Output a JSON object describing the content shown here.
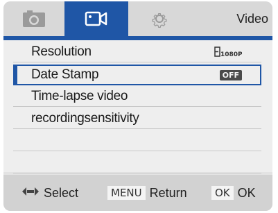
{
  "header": {
    "tabs": [
      {
        "name": "photo",
        "icon": "camera-icon",
        "active": false
      },
      {
        "name": "video",
        "icon": "video-camera-icon",
        "active": true
      },
      {
        "name": "setup",
        "icon": "gear-icon",
        "active": false
      }
    ],
    "mode_label": "Video"
  },
  "menu": {
    "items": [
      {
        "label": "Resolution",
        "value_icon": "1080p-icon",
        "selected": false
      },
      {
        "label": "Date Stamp",
        "value": "OFF",
        "selected": true
      },
      {
        "label": "Time-lapse video",
        "selected": false
      },
      {
        "label": "recordingsensitivity",
        "selected": false
      }
    ]
  },
  "footer": {
    "select_icon": "left-right-arrows-icon",
    "select_label": "Select",
    "menu_key": "MENU",
    "return_label": "Return",
    "ok_key": "OK",
    "ok_label": "OK"
  },
  "colors": {
    "accent": "#1f56a6",
    "background": "#e3e3e3"
  }
}
